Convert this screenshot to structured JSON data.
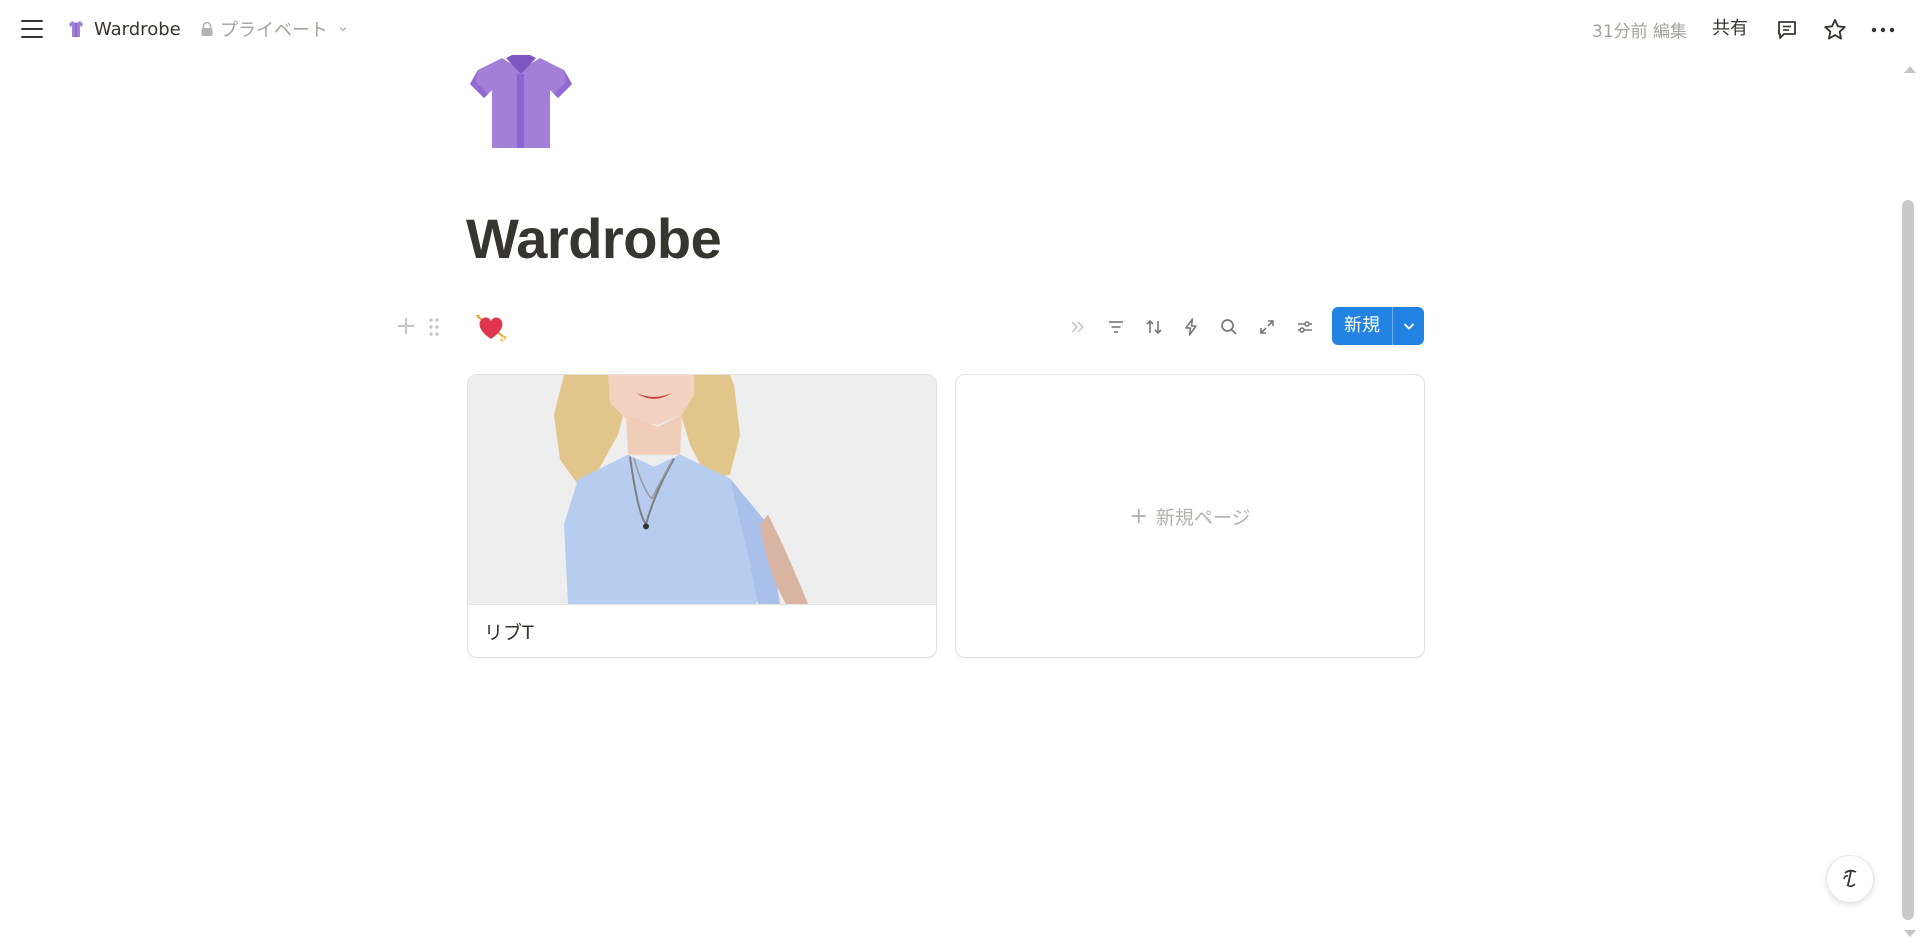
{
  "topbar": {
    "breadcrumb_title": "Wardrobe",
    "privacy_label": "プライベート",
    "edited_label": "31分前 編集",
    "share_label": "共有"
  },
  "page": {
    "title": "Wardrobe"
  },
  "database": {
    "new_label": "新規"
  },
  "gallery": {
    "cards": [
      {
        "title": "リブT"
      }
    ],
    "new_page_label": "新規ページ"
  },
  "colors": {
    "accent": "#2383e2",
    "text": "#37352f",
    "muted": "#a5a29c",
    "shirt": "#a47fd8"
  },
  "icons": {
    "page_icon": "purple-blouse-icon",
    "view_icon": "heart-with-arrow-icon"
  }
}
